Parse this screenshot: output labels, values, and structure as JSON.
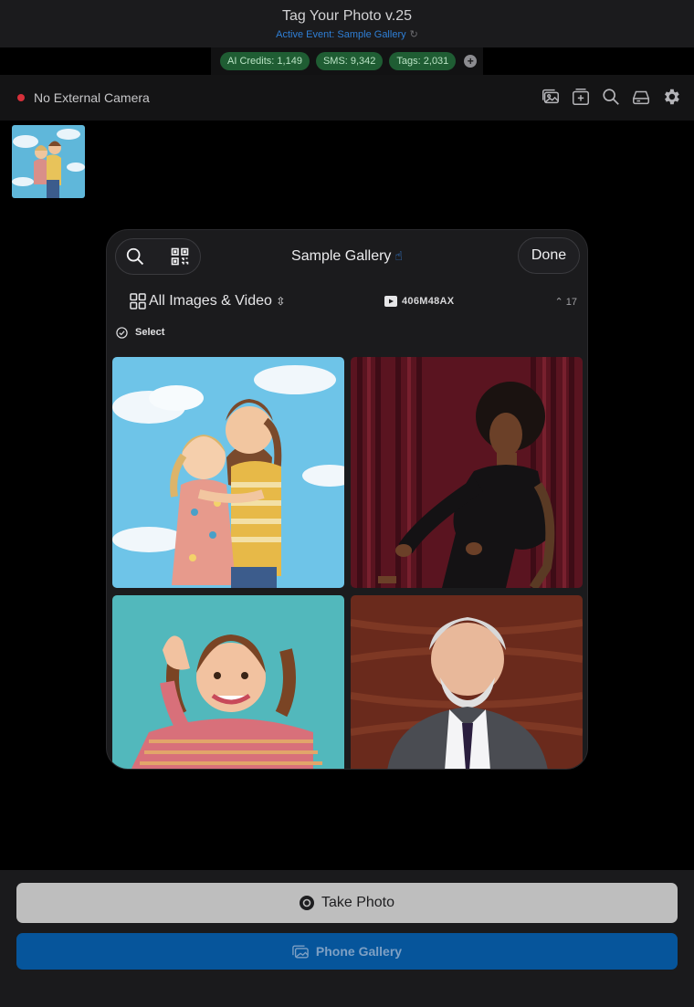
{
  "header": {
    "title": "Tag Your Photo v.25",
    "event_line": "Active Event: Sample Gallery"
  },
  "credits": {
    "ai": "AI Credits: 1,149",
    "sms": "SMS: 9,342",
    "tags": "Tags: 2,031",
    "add_icon": "plus-circle-icon"
  },
  "toolbar": {
    "camera_status": "No External Camera",
    "status_color": "#d6303a",
    "icons": [
      "photos-stack-icon",
      "add-frame-icon",
      "search-icon",
      "drive-icon",
      "gear-icon"
    ]
  },
  "modal": {
    "title": "Sample Gallery",
    "done_label": "Done",
    "filter_label": "All Images & Video",
    "video_code": "406M48AX",
    "count": "17",
    "select_label": "Select"
  },
  "bottom": {
    "take_photo_label": "Take Photo",
    "phone_gallery_label": "Phone Gallery",
    "accent": "#06559b"
  }
}
